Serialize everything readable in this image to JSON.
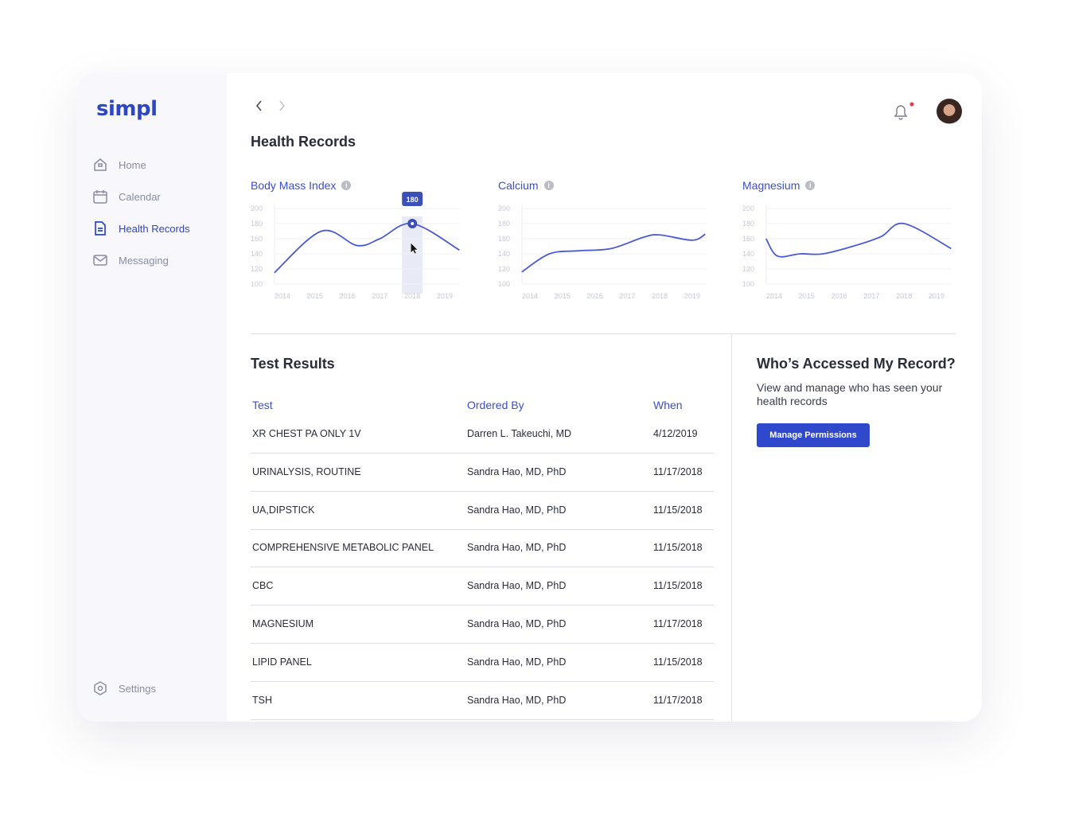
{
  "brand": "simpl",
  "sidebar": {
    "items": [
      {
        "label": "Home",
        "icon": "home-icon"
      },
      {
        "label": "Calendar",
        "icon": "calendar-icon"
      },
      {
        "label": "Health Records",
        "icon": "document-icon",
        "active": true
      },
      {
        "label": "Messaging",
        "icon": "mail-icon"
      }
    ],
    "settings": "Settings"
  },
  "header": {
    "title": "Health Records",
    "notification_dot": true
  },
  "colors": {
    "accent": "#3049cc",
    "line": "#4a5bd4",
    "notify": "#e53945"
  },
  "chart_data": [
    {
      "type": "line",
      "title": "Body Mass Index",
      "ylim": [
        100,
        200
      ],
      "yticks": [
        "200",
        "180",
        "160",
        "140",
        "120",
        "100"
      ],
      "xticks": [
        "2014",
        "2015",
        "2016",
        "2017",
        "2018",
        "2019"
      ],
      "points": [
        [
          2013.75,
          115
        ],
        [
          2015.2,
          170
        ],
        [
          2016.3,
          151
        ],
        [
          2017,
          160
        ],
        [
          2018,
          180
        ],
        [
          2019.45,
          145
        ]
      ],
      "highlight": {
        "x": "2018",
        "value": "180"
      }
    },
    {
      "type": "line",
      "title": "Calcium",
      "ylim": [
        100,
        200
      ],
      "yticks": [
        "200",
        "180",
        "160",
        "140",
        "120",
        "100"
      ],
      "xticks": [
        "2014",
        "2015",
        "2016",
        "2017",
        "2018",
        "2019"
      ],
      "points": [
        [
          2013.75,
          116
        ],
        [
          2014.6,
          140
        ],
        [
          2015.5,
          144
        ],
        [
          2016.5,
          147
        ],
        [
          2017.5,
          162
        ],
        [
          2018,
          165
        ],
        [
          2019,
          158
        ],
        [
          2019.4,
          166
        ]
      ]
    },
    {
      "type": "line",
      "title": "Magnesium",
      "ylim": [
        100,
        200
      ],
      "yticks": [
        "200",
        "180",
        "160",
        "140",
        "120",
        "100"
      ],
      "xticks": [
        "2014",
        "2015",
        "2016",
        "2017",
        "2018",
        "2019"
      ],
      "points": [
        [
          2013.75,
          160
        ],
        [
          2014.1,
          137
        ],
        [
          2014.8,
          140
        ],
        [
          2015.5,
          140
        ],
        [
          2016.5,
          151
        ],
        [
          2017.3,
          163
        ],
        [
          2018,
          180
        ],
        [
          2019.45,
          147
        ]
      ]
    }
  ],
  "tests": {
    "title": "Test Results",
    "columns": [
      "Test",
      "Ordered By",
      "When"
    ],
    "rows": [
      [
        "XR CHEST PA ONLY 1V",
        "Darren L. Takeuchi, MD",
        "4/12/2019"
      ],
      [
        "URINALYSIS, ROUTINE",
        "Sandra Hao, MD, PhD",
        "11/17/2018"
      ],
      [
        "UA,DIPSTICK",
        "Sandra Hao, MD, PhD",
        "11/15/2018"
      ],
      [
        "COMPREHENSIVE METABOLIC PANEL",
        "Sandra Hao, MD, PhD",
        "11/15/2018"
      ],
      [
        "CBC",
        "Sandra Hao, MD, PhD",
        "11/15/2018"
      ],
      [
        "MAGNESIUM",
        "Sandra Hao, MD, PhD",
        "11/17/2018"
      ],
      [
        "LIPID PANEL",
        "Sandra Hao, MD, PhD",
        "11/15/2018"
      ],
      [
        "TSH",
        "Sandra Hao, MD, PhD",
        "11/17/2018"
      ]
    ]
  },
  "access": {
    "title": "Who’s Accessed My Record?",
    "description": "View and manage who has seen your health records",
    "button": "Manage Permissions"
  }
}
